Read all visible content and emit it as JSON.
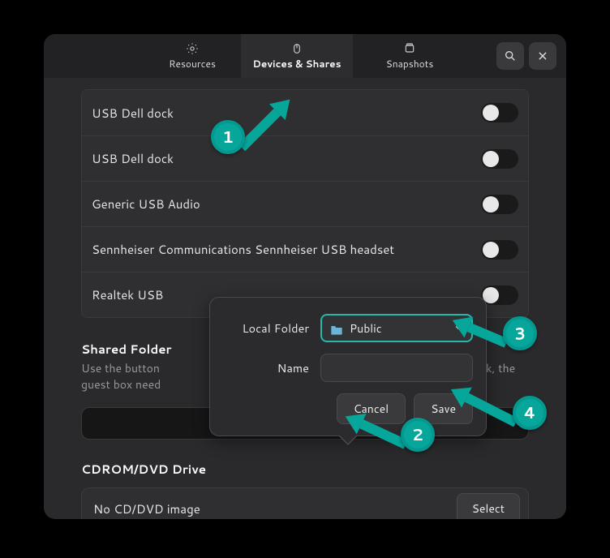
{
  "header": {
    "tabs": [
      {
        "label": "Resources",
        "active": false
      },
      {
        "label": "Devices & Shares",
        "active": true
      },
      {
        "label": "Snapshots",
        "active": false
      }
    ]
  },
  "devices": [
    {
      "label": "USB Dell dock",
      "on": false
    },
    {
      "label": "USB Dell dock",
      "on": false
    },
    {
      "label": "Generic USB Audio",
      "on": false
    },
    {
      "label": "Sennheiser Communications Sennheiser USB headset",
      "on": false
    },
    {
      "label": "Realtek USB",
      "on": false
    }
  ],
  "shared": {
    "title": "Shared Folder",
    "desc_before": "Use the button",
    "desc_after": "g to work, the guest box need"
  },
  "cdrom": {
    "title": "CDROM/DVD Drive",
    "row_label": "No CD/DVD image",
    "select_label": "Select"
  },
  "popover": {
    "local_folder_label": "Local Folder",
    "name_label": "Name",
    "selected_folder": "Public",
    "cancel": "Cancel",
    "save": "Save"
  },
  "annotation_numbers": {
    "n1": "1",
    "n2": "2",
    "n3": "3",
    "n4": "4"
  }
}
